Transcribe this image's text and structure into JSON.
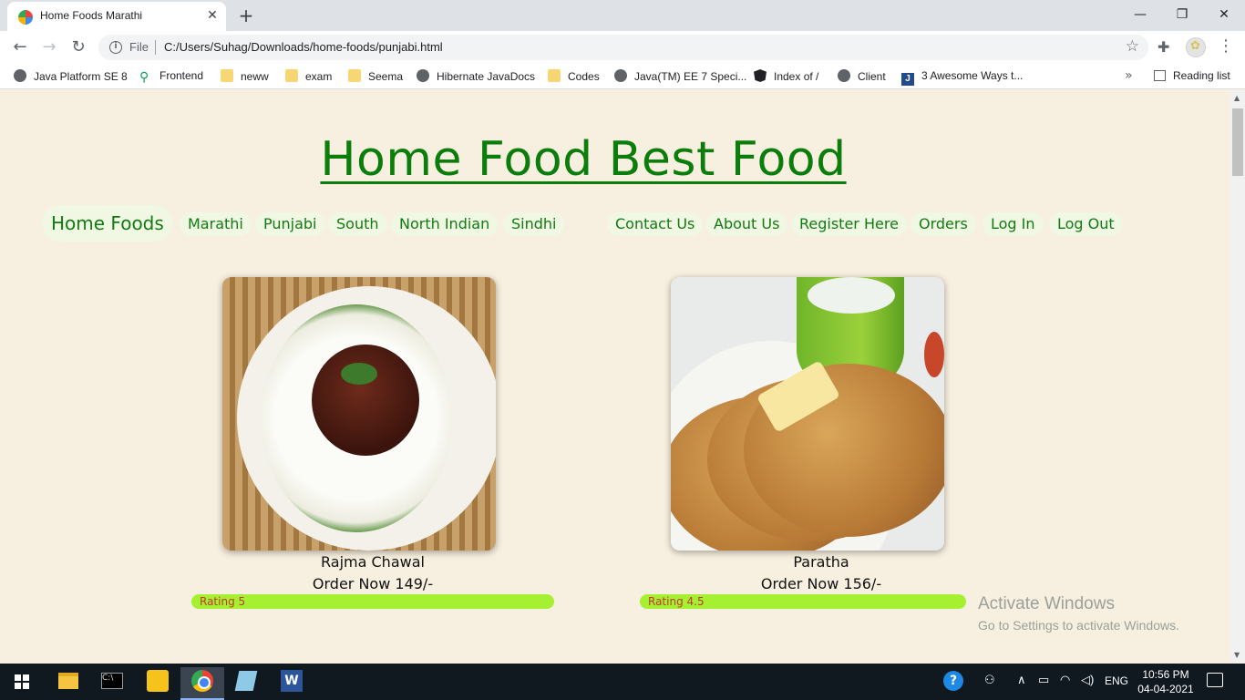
{
  "browser": {
    "tab_title": "Home Foods Marathi",
    "tab_close": "✕",
    "new_tab": "+",
    "window_controls": [
      "—",
      "❐",
      "✕"
    ],
    "scheme": "File",
    "url": "C:/Users/Suhag/Downloads/home-foods/punjabi.html",
    "bookmarks": [
      {
        "label": "Java Platform SE 8",
        "icon": "globe-icon"
      },
      {
        "label": "Frontend",
        "icon": "pin-icon"
      },
      {
        "label": "neww",
        "icon": "folder-icon"
      },
      {
        "label": "exam",
        "icon": "folder-icon"
      },
      {
        "label": "Seema",
        "icon": "folder-icon"
      },
      {
        "label": "Hibernate JavaDocs",
        "icon": "globe-icon"
      },
      {
        "label": "Codes",
        "icon": "folder-icon"
      },
      {
        "label": "Java(TM) EE 7 Speci...",
        "icon": "globe-icon"
      },
      {
        "label": "Index of /",
        "icon": "angular-icon"
      },
      {
        "label": "Client",
        "icon": "globe-icon"
      },
      {
        "label": "3 Awesome Ways t...",
        "icon": "j-icon"
      }
    ],
    "more_bookmarks": "»",
    "reading_list": "Reading list"
  },
  "page": {
    "title": "Home Food Best Food",
    "nav": {
      "brand": "Home Foods",
      "categories": [
        "Marathi",
        "Punjabi",
        "South",
        "North Indian",
        "Sindhi"
      ],
      "links": [
        "Contact Us",
        "About Us",
        "Register Here",
        "Orders",
        "Log In",
        "Log Out"
      ]
    },
    "dishes": [
      {
        "name": "Rajma Chawal",
        "price": "Order Now 149/-",
        "rating_label": "Rating 5",
        "rating": 5
      },
      {
        "name": "Paratha",
        "price": "Order Now 156/-",
        "rating_label": "Rating 4.5",
        "rating": 4.5
      }
    ]
  },
  "watermark": {
    "line1": "Activate Windows",
    "line2": "Go to Settings to activate Windows."
  },
  "taskbar": {
    "language": "ENG",
    "time": "10:56 PM",
    "date": "04-04-2021"
  },
  "colors": {
    "page_bg": "#f7efdf",
    "accent_green": "#0b7d0b",
    "pill_bg": "#f0f7e3",
    "rating_fill": "#a6f032",
    "rating_text": "#c0392b"
  }
}
